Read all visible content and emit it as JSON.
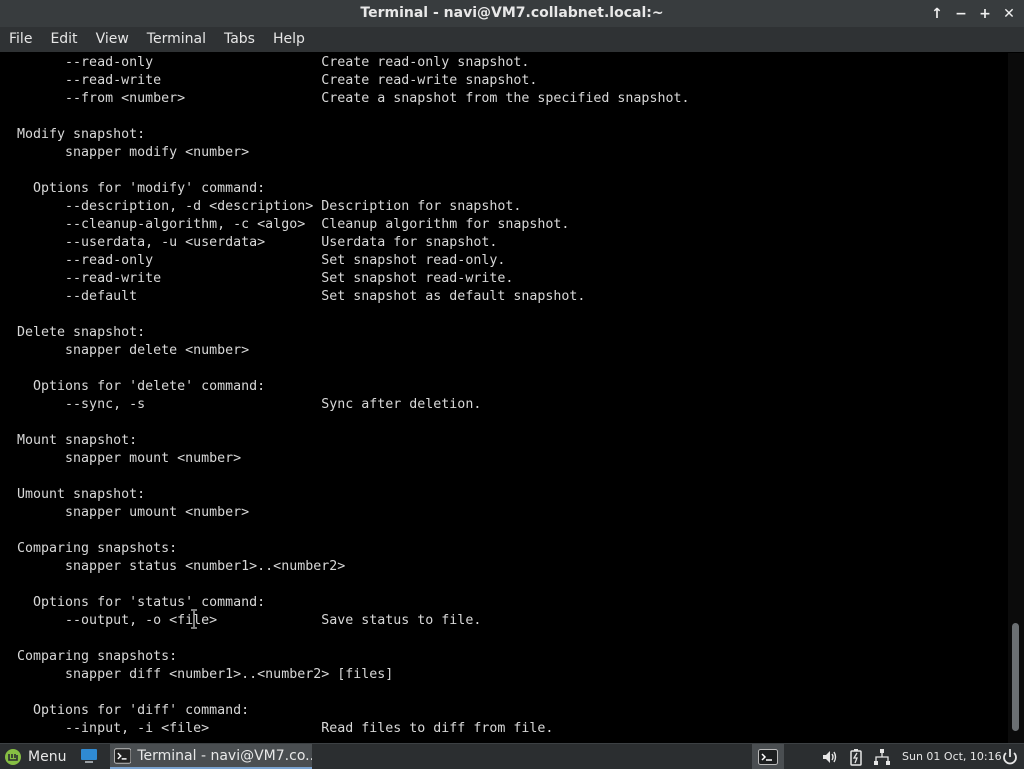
{
  "window": {
    "title": "Terminal - navi@VM7.collabnet.local:~"
  },
  "window_controls": {
    "keep_above": "↑",
    "minimize": "−",
    "maximize": "+",
    "close": "✕"
  },
  "menubar": {
    "items": [
      "File",
      "Edit",
      "View",
      "Terminal",
      "Tabs",
      "Help"
    ]
  },
  "terminal": {
    "lines": [
      "        --read-only                     Create read-only snapshot.",
      "        --read-write                    Create read-write snapshot.",
      "        --from <number>                 Create a snapshot from the specified snapshot.",
      "",
      "  Modify snapshot:",
      "        snapper modify <number>",
      "",
      "    Options for 'modify' command:",
      "        --description, -d <description> Description for snapshot.",
      "        --cleanup-algorithm, -c <algo>  Cleanup algorithm for snapshot.",
      "        --userdata, -u <userdata>       Userdata for snapshot.",
      "        --read-only                     Set snapshot read-only.",
      "        --read-write                    Set snapshot read-write.",
      "        --default                       Set snapshot as default snapshot.",
      "",
      "  Delete snapshot:",
      "        snapper delete <number>",
      "",
      "    Options for 'delete' command:",
      "        --sync, -s                      Sync after deletion.",
      "",
      "  Mount snapshot:",
      "        snapper mount <number>",
      "",
      "  Umount snapshot:",
      "        snapper umount <number>",
      "",
      "  Comparing snapshots:",
      "        snapper status <number1>..<number2>",
      "",
      "    Options for 'status' command:",
      "        --output, -o <file>             Save status to file.",
      "",
      "  Comparing snapshots:",
      "        snapper diff <number1>..<number2> [files]",
      "",
      "    Options for 'diff' command:",
      "        --input, -i <file>              Read files to diff from file."
    ]
  },
  "taskbar": {
    "menu_label": "Menu",
    "task_label": "Terminal - navi@VM7.co...",
    "clock": "Sun 01 Oct, 10:16"
  },
  "colors": {
    "titlebar": "#383c3e",
    "menubar": "#2f3234",
    "terminal_bg": "#000000",
    "terminal_fg": "#d8d8d8",
    "taskbar": "#2b2e30"
  },
  "icons": {
    "menu": "mint-logo-icon",
    "show_desktop": "show-desktop-icon",
    "task": "terminal-icon",
    "tray_terminal": "terminal-icon",
    "volume": "volume-icon",
    "battery": "battery-icon",
    "network": "network-icon",
    "power": "power-icon"
  }
}
